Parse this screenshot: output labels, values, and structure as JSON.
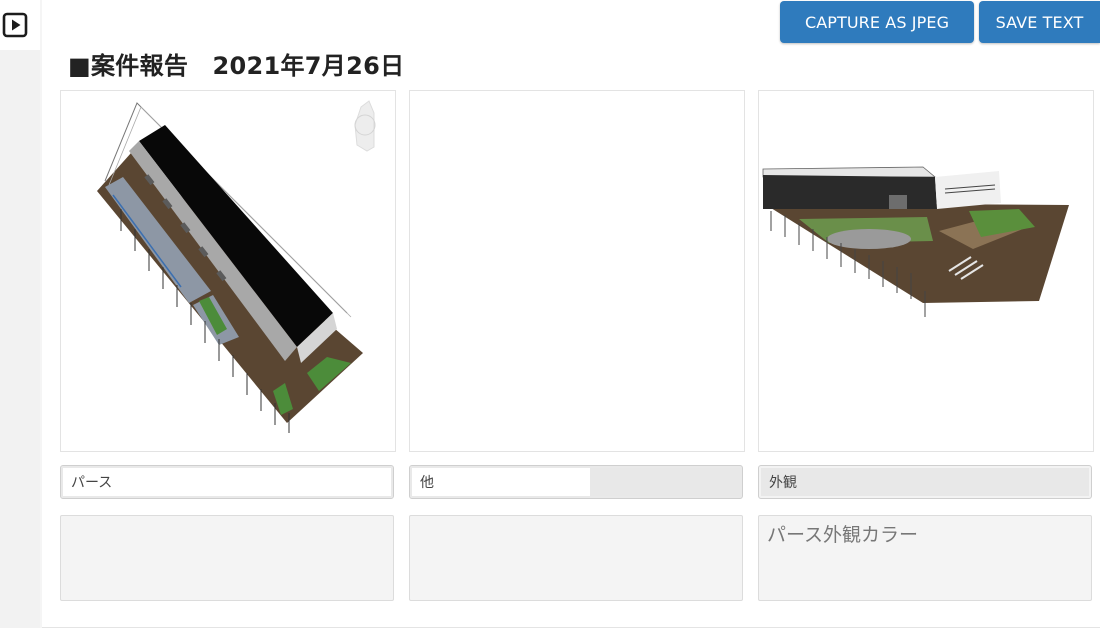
{
  "header": {
    "title": "■案件報告　2021年7月26日",
    "capture_button": "CAPTURE AS JPEG",
    "save_button": "SAVE TEXT"
  },
  "cards": [
    {
      "image": "aerial-isometric-warehouse-model",
      "field_value": "パース",
      "note": ""
    },
    {
      "image": "empty",
      "field_value": "他",
      "note": ""
    },
    {
      "image": "warehouse-exterior-perspective",
      "field_value": "外観",
      "note": "パース外観カラー"
    }
  ],
  "icons": {
    "play": "play-icon"
  },
  "colors": {
    "accent": "#2f7bbd"
  }
}
